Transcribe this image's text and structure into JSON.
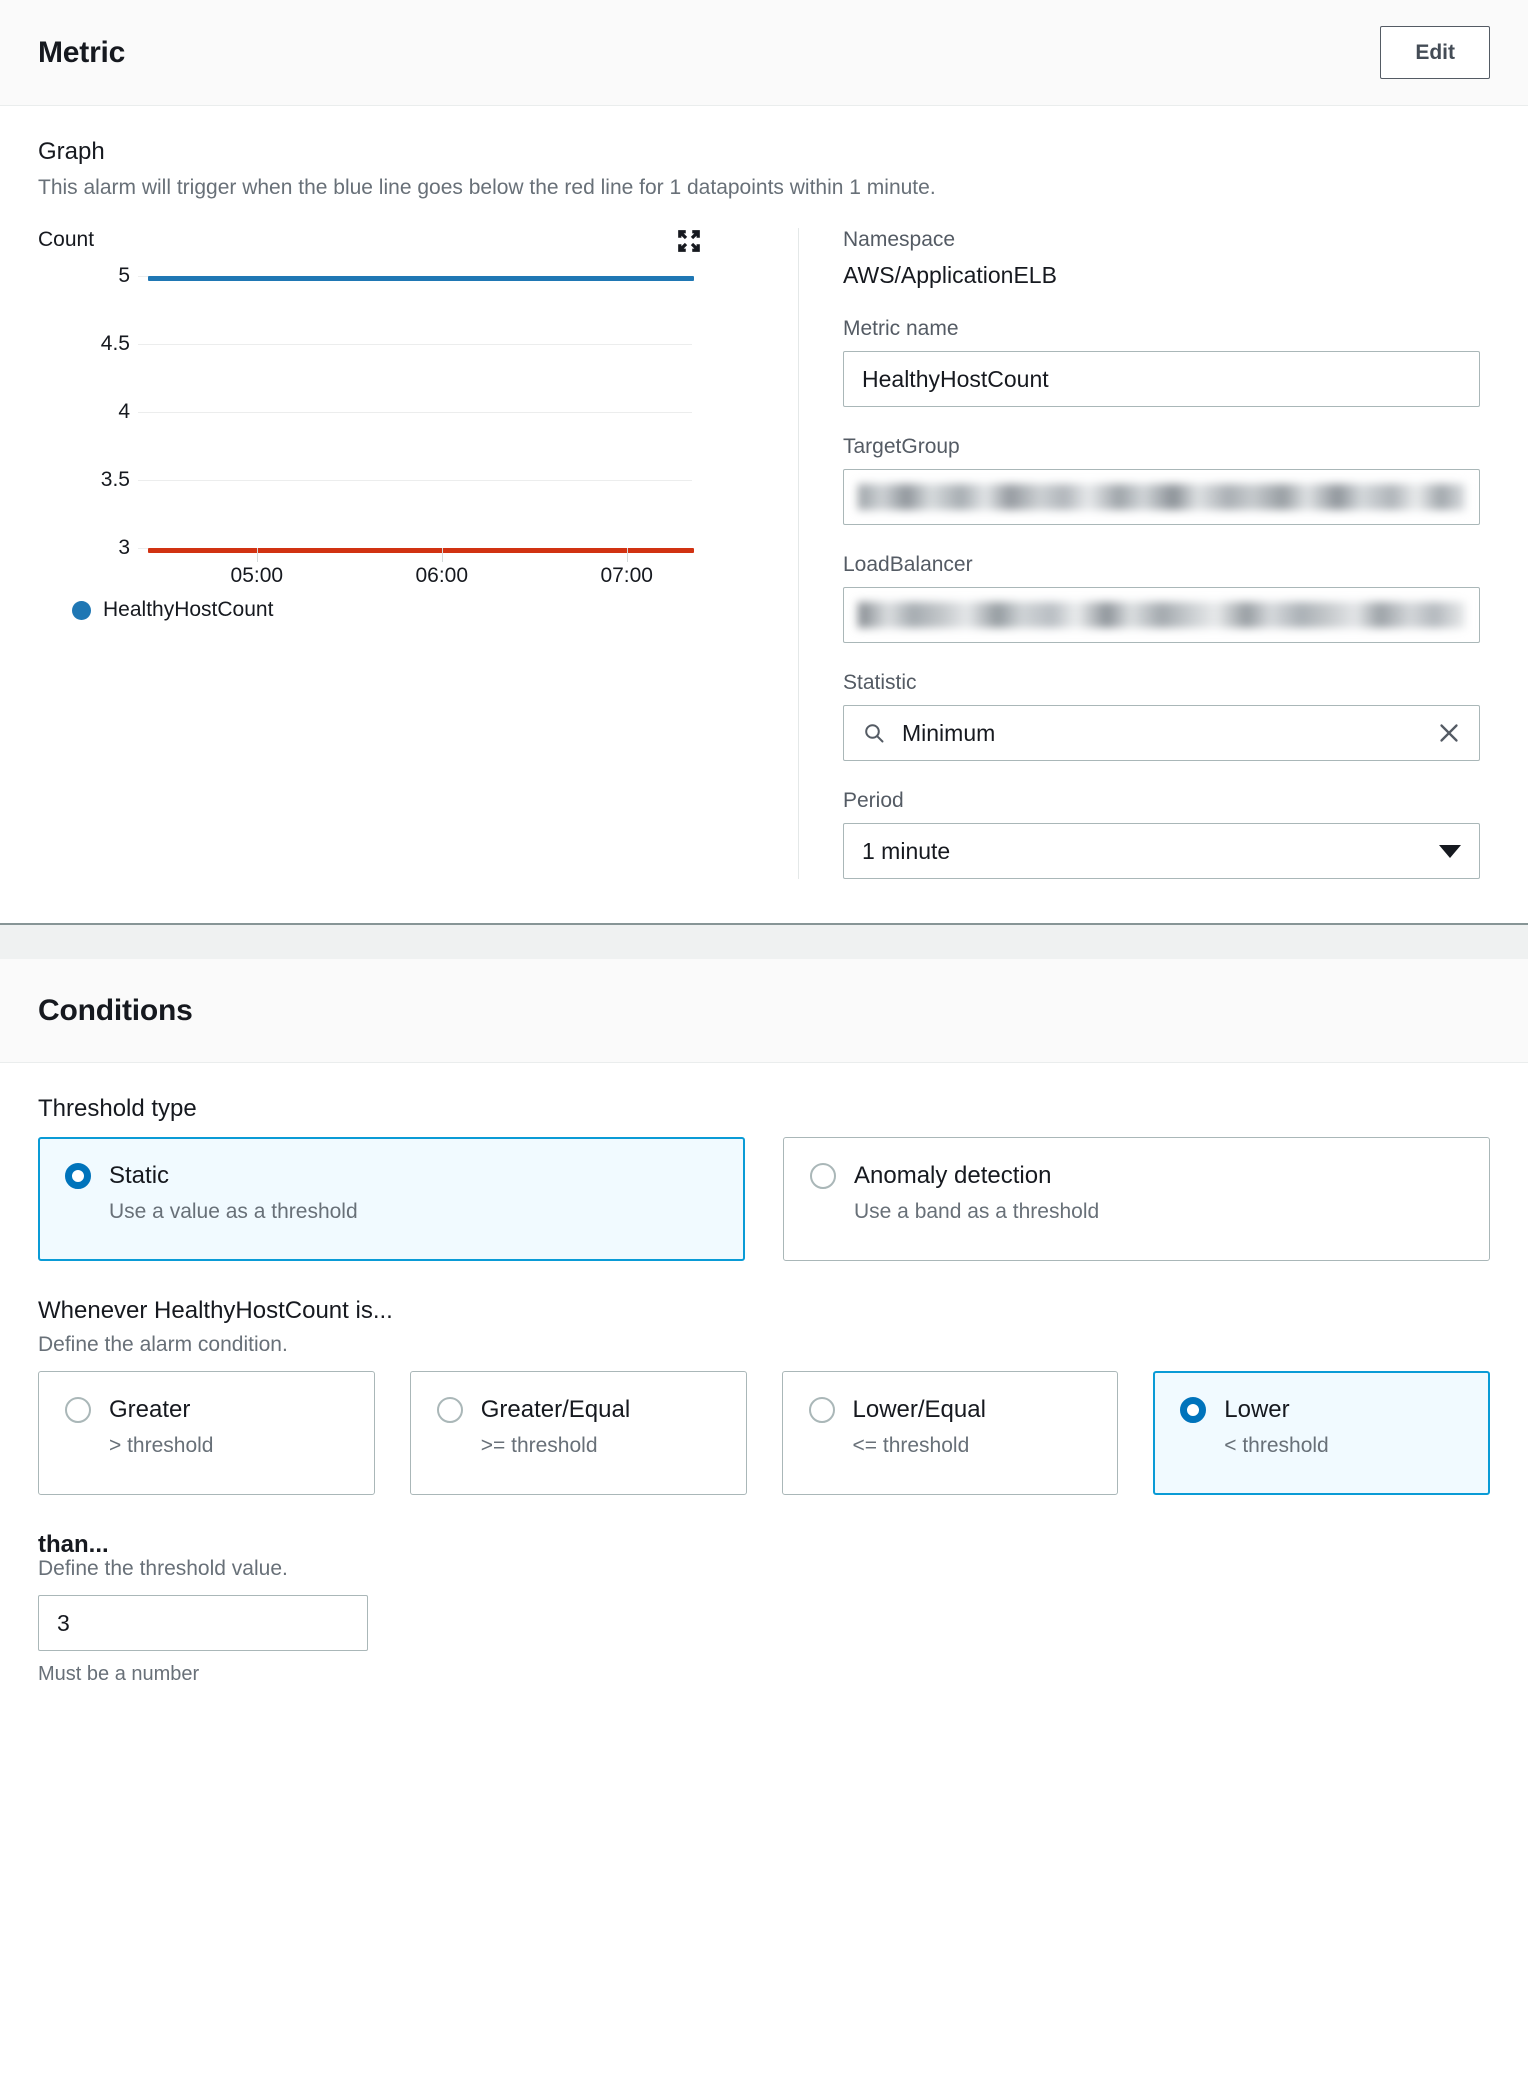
{
  "metric_panel": {
    "title": "Metric",
    "edit_label": "Edit",
    "graph_heading": "Graph",
    "graph_description": "This alarm will trigger when the blue line goes below the red line for 1 datapoints within 1 minute.",
    "expand_icon": "expand-arrows-icon"
  },
  "chart_data": {
    "type": "line",
    "title": "",
    "ylabel": "Count",
    "xlabel": "",
    "ylim": [
      3,
      5
    ],
    "y_ticks": [
      "5",
      "4.5",
      "4",
      "3.5",
      "3"
    ],
    "y_tick_values": [
      5,
      4.5,
      4,
      3.5,
      3
    ],
    "x_ticks": [
      "05:00",
      "06:00",
      "07:00"
    ],
    "grid": true,
    "legend_position": "bottom-left",
    "series": [
      {
        "name": "HealthyHostCount",
        "color": "#1f77b4",
        "value": 5,
        "values": [
          5,
          5,
          5,
          5,
          5,
          5,
          5,
          5,
          5,
          5
        ]
      },
      {
        "name": "Threshold",
        "color": "#d13212",
        "value": 3,
        "values": [
          3,
          3,
          3,
          3,
          3,
          3,
          3,
          3,
          3,
          3
        ]
      }
    ],
    "legend": [
      "HealthyHostCount"
    ]
  },
  "metric_form": {
    "namespace_label": "Namespace",
    "namespace_value": "AWS/ApplicationELB",
    "metric_name_label": "Metric name",
    "metric_name_value": "HealthyHostCount",
    "target_group_label": "TargetGroup",
    "target_group_value": "",
    "load_balancer_label": "LoadBalancer",
    "load_balancer_value": "",
    "statistic_label": "Statistic",
    "statistic_value": "Minimum",
    "statistic_search_icon": "search-icon",
    "statistic_clear_icon": "close-icon",
    "period_label": "Period",
    "period_value": "1 minute",
    "period_caret_icon": "chevron-down-icon"
  },
  "conditions_panel": {
    "title": "Conditions",
    "threshold_type_label": "Threshold type",
    "threshold_type_options": [
      {
        "title": "Static",
        "desc": "Use a value as a threshold",
        "selected": true
      },
      {
        "title": "Anomaly detection",
        "desc": "Use a band as a threshold",
        "selected": false
      }
    ],
    "whenever_label": "Whenever HealthyHostCount is...",
    "whenever_sub": "Define the alarm condition.",
    "comparison_options": [
      {
        "title": "Greater",
        "desc": "> threshold",
        "selected": false
      },
      {
        "title": "Greater/Equal",
        "desc": ">= threshold",
        "selected": false
      },
      {
        "title": "Lower/Equal",
        "desc": "<= threshold",
        "selected": false
      },
      {
        "title": "Lower",
        "desc": "< threshold",
        "selected": true
      }
    ],
    "than_label": "than...",
    "than_sub": "Define the threshold value.",
    "threshold_value": "3",
    "threshold_helper": "Must be a number"
  },
  "colors": {
    "accent_blue": "#0073bb",
    "selected_border": "#0a9bd6",
    "selected_bg": "#f1faff",
    "series_blue": "#1f77b4",
    "threshold_red": "#d13212",
    "header_bg": "#fafafa",
    "border_gray": "#aab7b8"
  }
}
